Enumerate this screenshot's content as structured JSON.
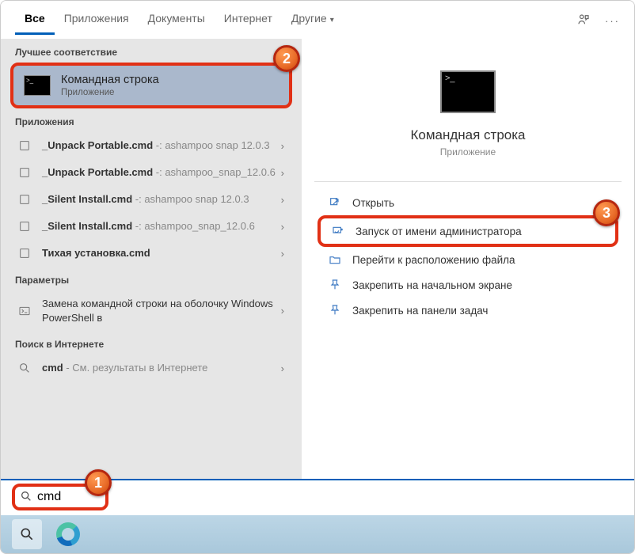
{
  "tabs": {
    "all": "Все",
    "apps": "Приложения",
    "docs": "Документы",
    "internet": "Интернет",
    "other": "Другие"
  },
  "sections": {
    "best": "Лучшее соответствие",
    "apps": "Приложения",
    "params": "Параметры",
    "web": "Поиск в Интернете"
  },
  "bestMatch": {
    "title": "Командная строка",
    "subtitle": "Приложение"
  },
  "appsList": [
    {
      "name": "_Unpack Portable.cmd",
      "suffix": " -: ashampoo snap 12.0.3"
    },
    {
      "name": "_Unpack Portable.cmd",
      "suffix": " -: ashampoo_snap_12.0.6"
    },
    {
      "name": "_Silent Install.cmd",
      "suffix": " -: ashampoo snap 12.0.3"
    },
    {
      "name": "_Silent Install.cmd",
      "suffix": " -: ashampoo_snap_12.0.6"
    },
    {
      "name": "Тихая установка.cmd",
      "suffix": ""
    }
  ],
  "paramsList": [
    {
      "text": "Замена командной строки на оболочку Windows PowerShell в"
    }
  ],
  "webList": [
    {
      "prefix": "cmd",
      "suffix": " - См. результаты в Интернете"
    }
  ],
  "preview": {
    "title": "Командная строка",
    "subtitle": "Приложение"
  },
  "actions": {
    "open": "Открыть",
    "admin": "Запуск от имени администратора",
    "location": "Перейти к расположению файла",
    "pinStart": "Закрепить на начальном экране",
    "pinTaskbar": "Закрепить на панели задач"
  },
  "search": {
    "query": "cmd"
  },
  "badges": {
    "b1": "1",
    "b2": "2",
    "b3": "3"
  }
}
